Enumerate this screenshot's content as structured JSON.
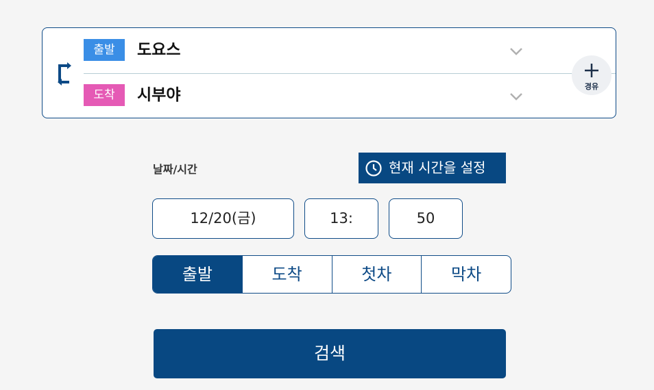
{
  "route": {
    "departure": {
      "tag": "출발",
      "station": "도요스"
    },
    "arrival": {
      "tag": "도착",
      "station": "시부야"
    },
    "via_label": "경유",
    "swap_icon": "swap-icon",
    "colors": {
      "departure_tag": "#3a8ee6",
      "arrival_tag": "#e55ab5",
      "border": "#0d4a86"
    }
  },
  "datetime": {
    "label": "날짜/시간",
    "now_button": "현재 시간을 설정",
    "date": "12/20(금)",
    "hour": "13:",
    "minute": "50"
  },
  "mode_tabs": [
    {
      "label": "출발",
      "active": true
    },
    {
      "label": "도착",
      "active": false
    },
    {
      "label": "첫차",
      "active": false
    },
    {
      "label": "막차",
      "active": false
    }
  ],
  "search_button": "검색",
  "accent_color": "#084882"
}
